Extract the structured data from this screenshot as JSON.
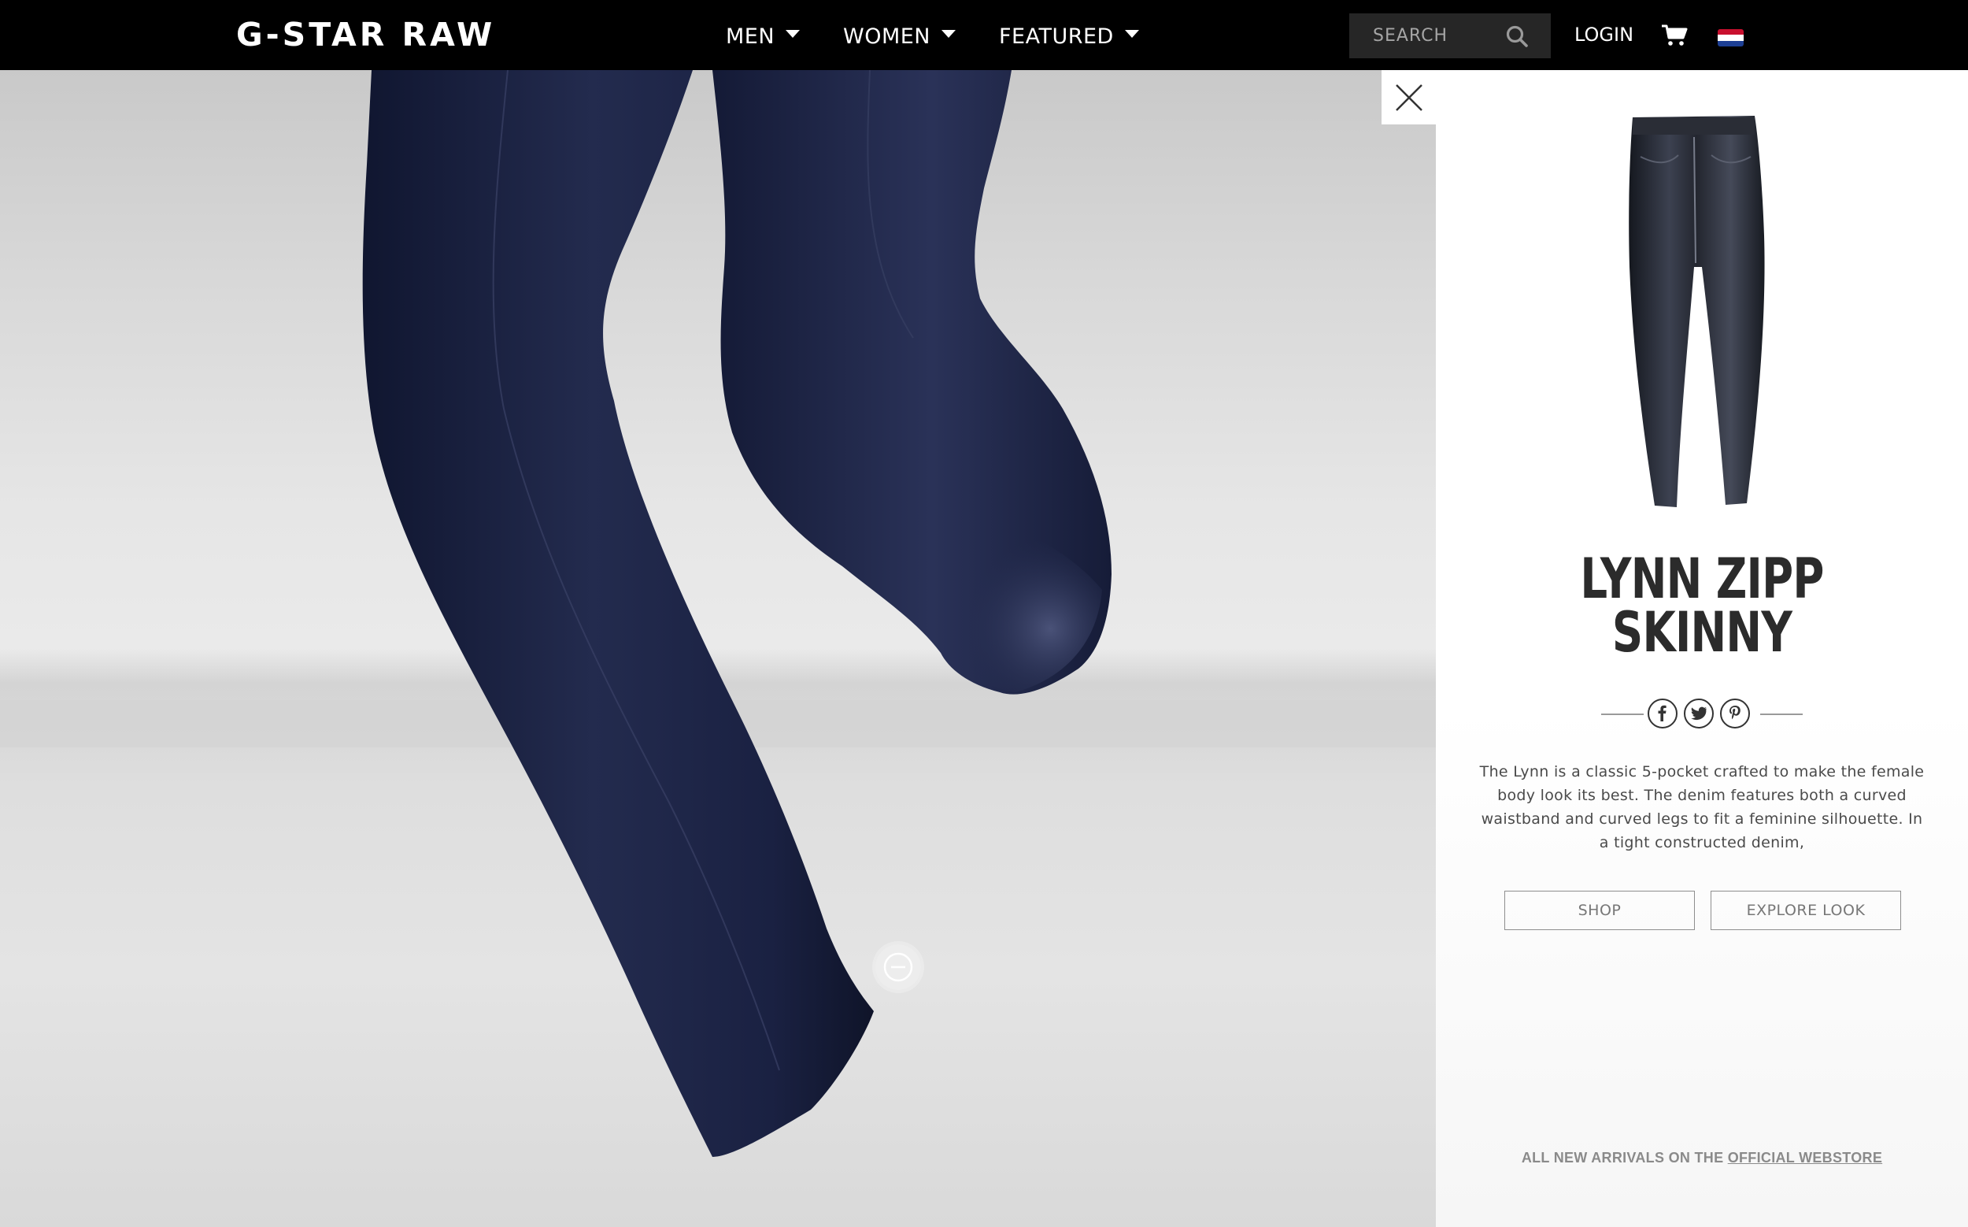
{
  "header": {
    "logo": "G-STAR RAW",
    "nav": [
      {
        "label": "MEN"
      },
      {
        "label": "WOMEN"
      },
      {
        "label": "FEATURED"
      }
    ],
    "search": {
      "placeholder": "SEARCH",
      "value": ""
    },
    "login_label": "LOGIN"
  },
  "product": {
    "title_line1": "LYNN ZIPP",
    "title_line2": "SKINNY",
    "description": "The Lynn is a classic 5-pocket crafted to make the female body look its best. The denim features both a curved waistband and curved legs to fit a feminine silhouette. In a tight constructed denim,",
    "shop_label": "SHOP",
    "explore_label": "EXPLORE LOOK"
  },
  "footer": {
    "prefix": "ALL NEW ARRIVALS ON THE ",
    "link_label": "OFFICIAL WEBSTORE"
  },
  "icons": {
    "search": "search-icon",
    "cart": "cart-icon",
    "flag": "netherlands-flag-icon",
    "close": "close-icon",
    "zoom_out": "zoom-out-icon",
    "facebook": "facebook-icon",
    "twitter": "twitter-icon",
    "pinterest": "pinterest-icon"
  },
  "colors": {
    "topbar": "#000000",
    "search_bg": "#262626",
    "denim": "#1c2340",
    "panel_text": "#2b2b2b"
  }
}
